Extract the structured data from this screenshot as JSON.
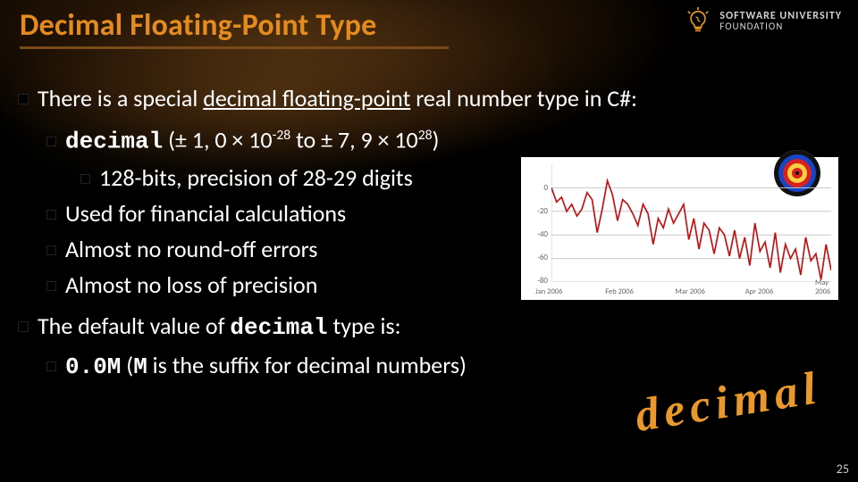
{
  "title": "Decimal Floating-Point Type",
  "logo": {
    "line1": "SOFTWARE UNIVERSITY",
    "line2": "FOUNDATION"
  },
  "bullets": {
    "b1a": "There is a special ",
    "b1b": "decimal floating-point",
    "b1c": " real number type in C#:",
    "b2a_code": "decimal",
    "b2a_rest": " (± 1, 0 × 10",
    "b2a_exp1": "-28",
    "b2a_mid": " to ± 7, 9 × 10",
    "b2a_exp2": "28",
    "b2a_end": ")",
    "b3a": "128-bits, precision of 28-29 digits",
    "b2b": "Used for financial calculations",
    "b2c": "Almost no round-off errors",
    "b2d": "Almost no loss of precision",
    "b1d_a": "The default value of ",
    "b1d_code": "decimal",
    "b1d_b": " type is:",
    "b2e_code": "0.0M",
    "b2e_rest1": " (",
    "b2e_M": "M",
    "b2e_rest2": " is the suffix for decimal numbers)"
  },
  "decoration_word": "decimal",
  "slide_number": "25",
  "chart_data": {
    "type": "line",
    "title": "",
    "xlabel": "",
    "ylabel": "",
    "ylim": [
      -80,
      20
    ],
    "y_ticks": [
      0,
      -20,
      -40,
      -60,
      -80
    ],
    "categories": [
      "Jan 2006",
      "Feb 2006",
      "Mar 2006",
      "Apr 2006",
      "May 2006"
    ],
    "values": [
      0,
      -12,
      -8,
      -20,
      -14,
      -24,
      -18,
      -4,
      -10,
      -38,
      -18,
      6,
      -6,
      -28,
      -10,
      -14,
      -22,
      -32,
      -14,
      -22,
      -48,
      -26,
      -34,
      -18,
      -30,
      -22,
      -14,
      -44,
      -26,
      -52,
      -30,
      -36,
      -56,
      -34,
      -40,
      -58,
      -36,
      -60,
      -42,
      -66,
      -30,
      -54,
      -46,
      -68,
      -38,
      -72,
      -48,
      -60,
      -52,
      -74,
      -42,
      -62,
      -56,
      -78,
      -48,
      -70
    ]
  }
}
